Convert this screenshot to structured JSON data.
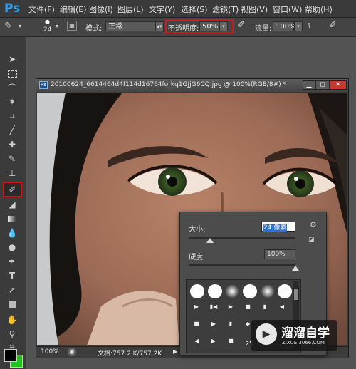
{
  "app": {
    "logo": "Ps"
  },
  "menu": [
    "文件(F)",
    "编辑(E)",
    "图像(I)",
    "图层(L)",
    "文字(Y)",
    "选择(S)",
    "滤镜(T)",
    "视图(V)",
    "窗口(W)",
    "帮助(H)"
  ],
  "options_bar": {
    "brush_size": "24",
    "mode_label": "模式:",
    "mode_value": "正常",
    "opacity_label": "不透明度:",
    "opacity_value": "50%",
    "flow_label": "流量:",
    "flow_value": "100%"
  },
  "document": {
    "title": "20100624_6614464d4f114d16764forkq1GJjG6CQ.jpg @ 100%(RGB/8#) *",
    "ps_badge": "Ps",
    "zoom": "100%",
    "doc_info": "文档:757.2 K/757.2K"
  },
  "brush_popup": {
    "size_label": "大小:",
    "size_value": "24 像素",
    "hardness_label": "硬度:",
    "hardness_value": "100%",
    "size_slider_fraction": 0.2,
    "hardness_slider_fraction": 1.0,
    "visible_number": "25"
  },
  "watermark": {
    "text": "溜溜自学",
    "sub": "ZIXUE.3066.COM"
  },
  "colors": {
    "highlight": "#d0171c",
    "selection": "#2f6fcf",
    "ps_blue": "#3aa0e8"
  }
}
